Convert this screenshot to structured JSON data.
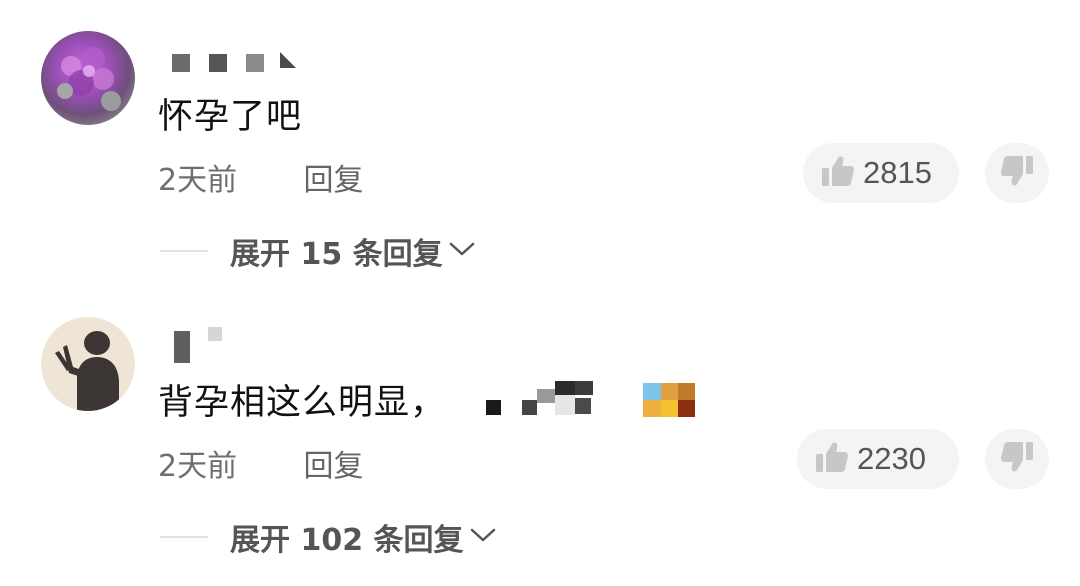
{
  "comments": [
    {
      "body": "怀孕了吧",
      "time": "2天前",
      "reply_label": "回复",
      "likes": "2815",
      "expand_label": "展开 15 条回复",
      "avatar": "purple-flower-photo"
    },
    {
      "body": "背孕相这么明显，",
      "time": "2天前",
      "reply_label": "回复",
      "likes": "2230",
      "expand_label": "展开 102 条回复",
      "avatar": "silhouette-peace-sign"
    }
  ],
  "icons": {
    "like": "thumbs-up-icon",
    "dislike": "thumbs-down-icon",
    "expand": "chevron-down-icon"
  },
  "colors": {
    "text": "#111111",
    "meta": "#6f6f6f",
    "pill": "#f4f4f4"
  }
}
